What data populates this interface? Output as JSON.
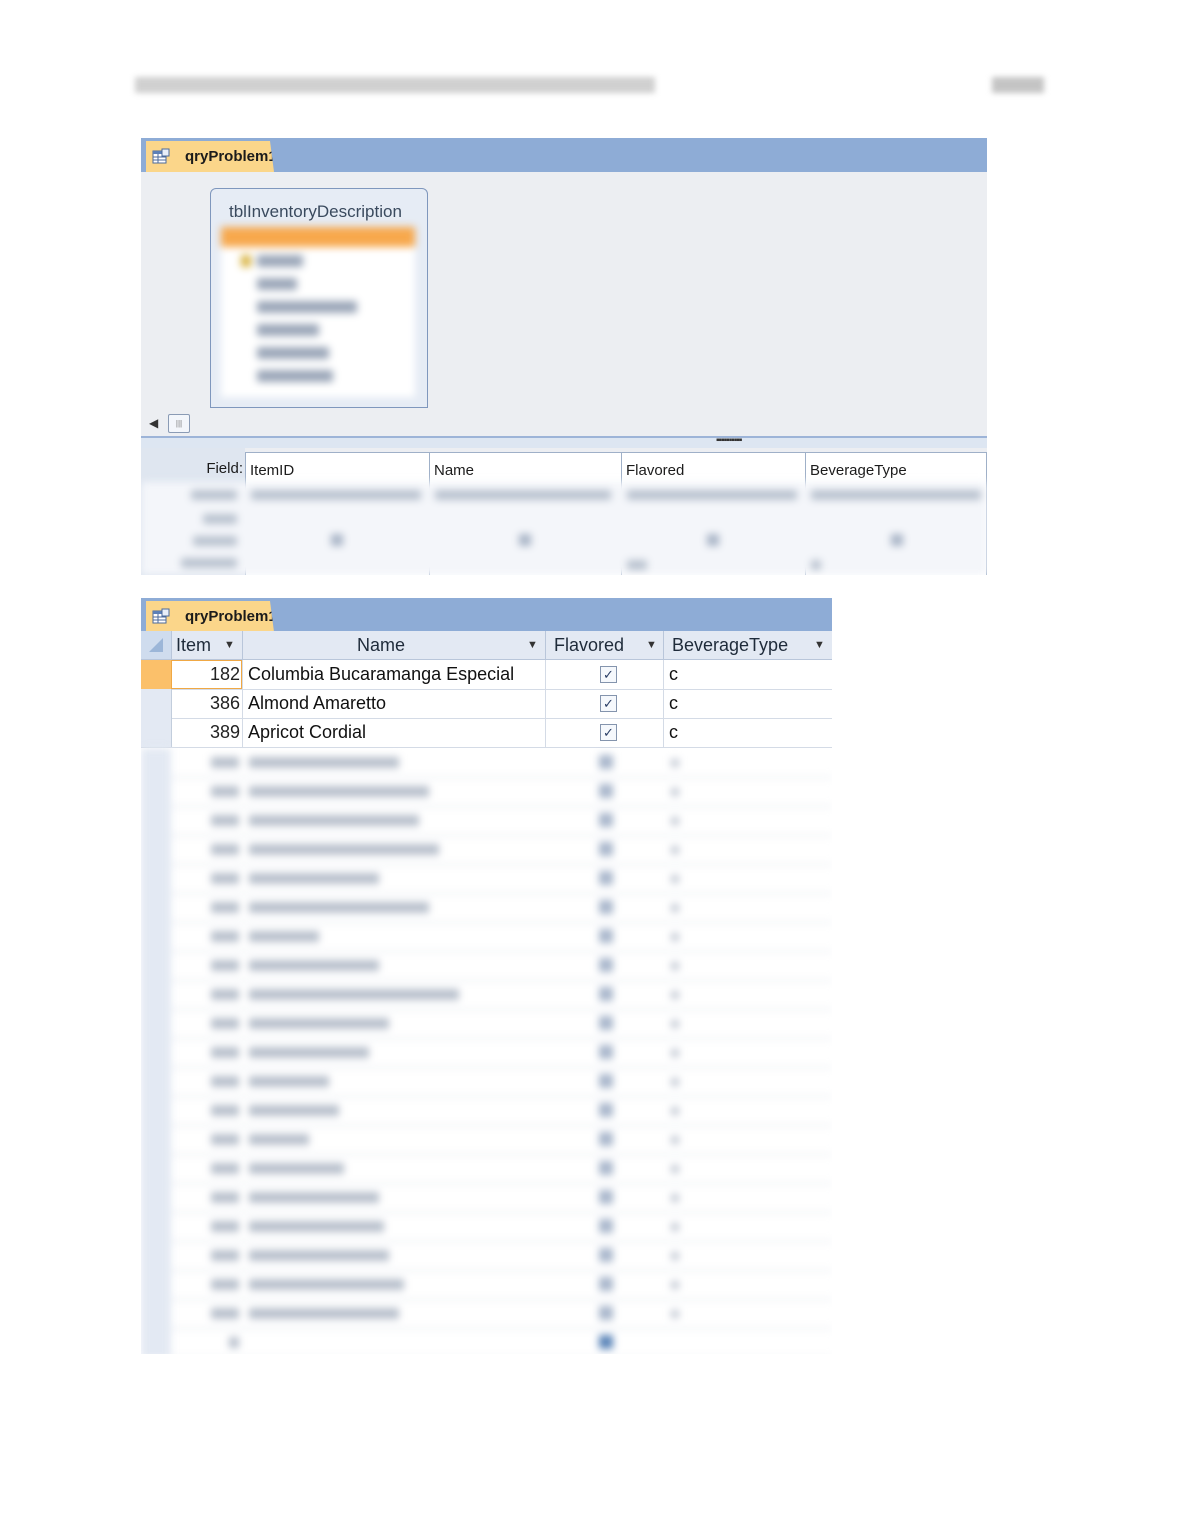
{
  "design_window": {
    "tab_title": "qryProblem1",
    "table_title": "tblInventoryDescription",
    "grid": {
      "row_label": "Field:",
      "fields": [
        "ItemID",
        "Name",
        "Flavored",
        "BeverageType"
      ]
    }
  },
  "datasheet": {
    "tab_title": "qryProblem1",
    "columns": [
      "Item",
      "Name",
      "Flavored",
      "BeverageType"
    ],
    "rows": [
      {
        "item": "182",
        "name": "Columbia Bucaramanga Especial",
        "flavored": true,
        "type": "c"
      },
      {
        "item": "386",
        "name": "Almond Amaretto",
        "flavored": true,
        "type": "c"
      },
      {
        "item": "389",
        "name": "Apricot Cordial",
        "flavored": true,
        "type": "c"
      }
    ]
  },
  "icons": {
    "dropdown": "dropdown-arrow-icon",
    "checkbox_checked": "check-icon",
    "query_tab": "query-icon",
    "scroll_left": "arrow-left-icon"
  },
  "colors": {
    "tab_bar": "#8eacd6",
    "active_tab": "#fbd68a",
    "selected_row": "#fbc06a"
  }
}
